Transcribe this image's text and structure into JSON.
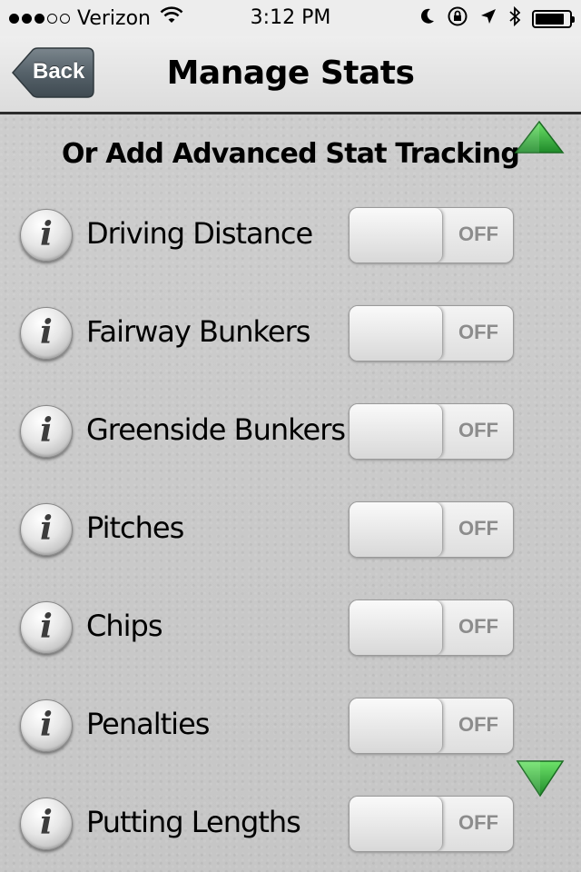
{
  "status_bar": {
    "carrier": "Verizon",
    "time": "3:12 PM",
    "signal_bars_filled": 3,
    "signal_bars_total": 5,
    "battery_level": 0.85
  },
  "nav": {
    "back_label": "Back",
    "title": "Manage Stats"
  },
  "section": {
    "title": "Or Add Advanced Stat Tracking"
  },
  "stats": [
    {
      "label": "Driving Distance",
      "state": "OFF"
    },
    {
      "label": "Fairway Bunkers",
      "state": "OFF"
    },
    {
      "label": "Greenside Bunkers",
      "state": "OFF"
    },
    {
      "label": "Pitches",
      "state": "OFF"
    },
    {
      "label": "Chips",
      "state": "OFF"
    },
    {
      "label": "Penalties",
      "state": "OFF"
    },
    {
      "label": "Putting Lengths",
      "state": "OFF"
    }
  ],
  "info_glyph": "i",
  "colors": {
    "arrow_green": "#2fa336",
    "back_button": "#4d5961",
    "background": "#c9c9c9"
  }
}
